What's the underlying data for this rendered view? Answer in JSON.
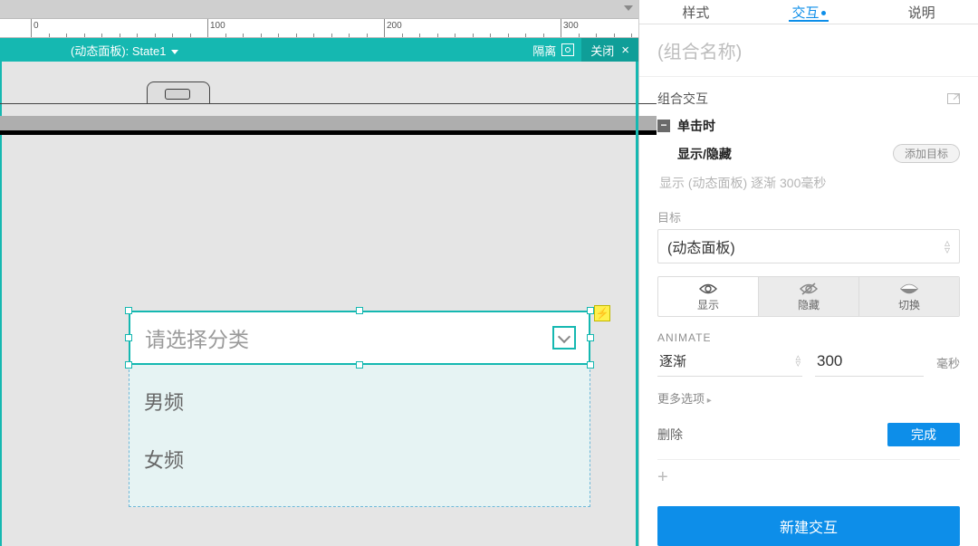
{
  "ruler": {
    "marks": [
      0,
      100,
      200,
      300
    ]
  },
  "stateBar": {
    "title": "(动态面板): State1",
    "isolate": "隔离",
    "close": "关闭"
  },
  "canvas": {
    "placeholder": "请选择分类",
    "options": [
      "男频",
      "女频"
    ]
  },
  "inspector": {
    "tabs": {
      "style": "样式",
      "interaction": "交互",
      "notes": "说明"
    },
    "groupName": "(组合名称)",
    "sectionTitle": "组合交互",
    "event": "单击时",
    "action": "显示/隐藏",
    "addTarget": "添加目标",
    "summary": "显示 (动态面板) 逐渐 300毫秒",
    "targetLabel": "目标",
    "targetValue": "(动态面板)",
    "visibility": {
      "show": "显示",
      "hide": "隐藏",
      "toggle": "切换"
    },
    "animateLabel": "ANIMATE",
    "animateType": "逐渐",
    "animateDuration": "300",
    "animateUnit": "毫秒",
    "moreOptions": "更多选项",
    "delete": "删除",
    "done": "完成",
    "newInteraction": "新建交互"
  }
}
